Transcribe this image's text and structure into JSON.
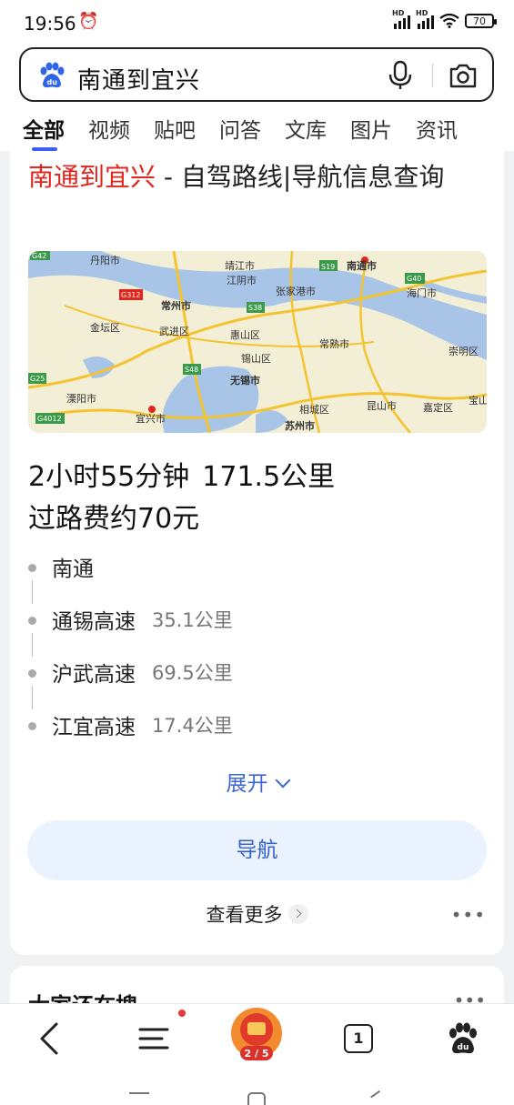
{
  "status_bar": {
    "time": "19:56",
    "battery": "70",
    "signal_label": "HD"
  },
  "search": {
    "query": "南通到宜兴"
  },
  "tabs": [
    {
      "label": "全部",
      "active": true
    },
    {
      "label": "视频"
    },
    {
      "label": "贴吧"
    },
    {
      "label": "问答"
    },
    {
      "label": "文库"
    },
    {
      "label": "图片"
    },
    {
      "label": "资讯"
    }
  ],
  "result": {
    "title_highlight": "南通到宜兴",
    "title_rest": " - 自驾路线|导航信息查询",
    "map_labels": [
      "丹阳市",
      "靖江市",
      "江阴市",
      "南通市",
      "张家港市",
      "海门市",
      "常州市",
      "武进区",
      "金坛区",
      "惠山区",
      "锡山区",
      "常熟市",
      "崇明区",
      "无锡市",
      "溧阳市",
      "宜兴市",
      "相城区",
      "昆山市",
      "嘉定区",
      "宝山",
      "苏州市",
      "G42",
      "G312",
      "S19",
      "S38",
      "G40",
      "S48",
      "G25",
      "G4012"
    ],
    "duration": "2小时55分钟",
    "distance": "171.5公里",
    "toll": "过路费约70元",
    "steps": [
      {
        "name": "南通",
        "dist": ""
      },
      {
        "name": "通锡高速",
        "dist": "35.1公里"
      },
      {
        "name": "沪武高速",
        "dist": "69.5公里"
      },
      {
        "name": "江宜高速",
        "dist": "17.4公里"
      }
    ],
    "expand_label": "展开",
    "navigate_label": "导航",
    "more_label": "查看更多",
    "menu_dots": "•••"
  },
  "next_card": {
    "title": "大家还在搜",
    "dots": "•••"
  },
  "bottom_nav": {
    "tab_count": "1",
    "lottery_progress": "2 / 5"
  }
}
